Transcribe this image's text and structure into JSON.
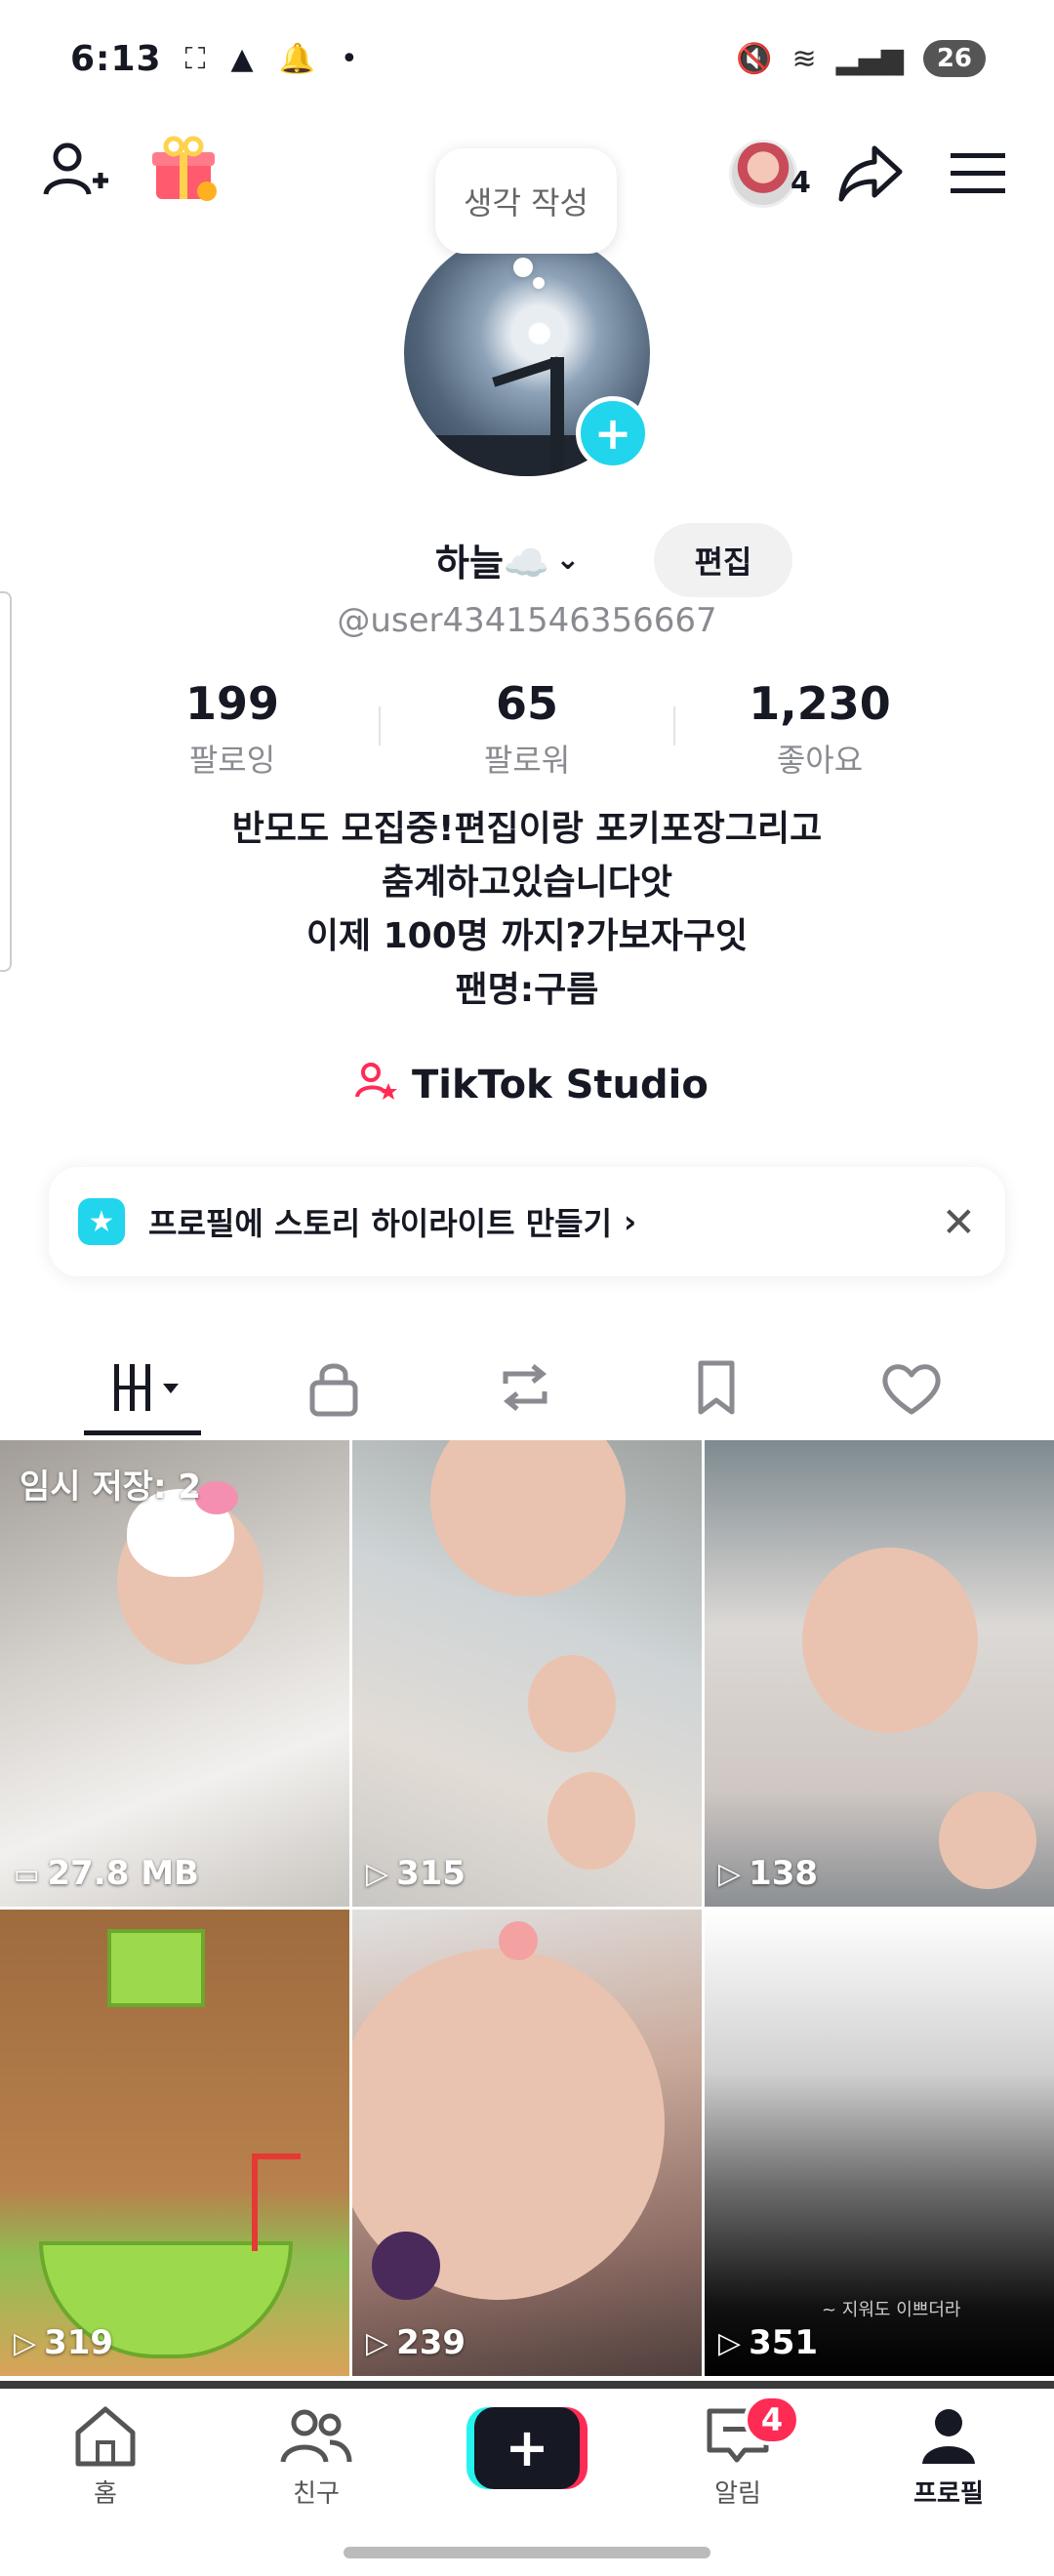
{
  "status_bar": {
    "time": "6:13",
    "battery": "26"
  },
  "top_nav": {
    "avatar_count": "4"
  },
  "thought_bubble": {
    "text": "생각 작성"
  },
  "profile": {
    "display_name": "하늘☁️",
    "edit_label": "편집",
    "username": "@user4341546356667"
  },
  "stats": {
    "following": {
      "value": "199",
      "label": "팔로잉"
    },
    "followers": {
      "value": "65",
      "label": "팔로워"
    },
    "likes": {
      "value": "1,230",
      "label": "좋아요"
    }
  },
  "bio": {
    "lines": [
      "반모도 모집중!편집이랑 포키포장그리고",
      "춤계하고있습니다앗",
      "이제 100명 까지?가보자구잇",
      "팬명:구름"
    ]
  },
  "studio": {
    "label": "TikTok Studio"
  },
  "story_banner": {
    "text": "프로필에 스토리 하이라이트 만들기"
  },
  "tabs": [
    {
      "name": "videos",
      "icon": "grid-icon"
    },
    {
      "name": "private",
      "icon": "lock-icon"
    },
    {
      "name": "reposts",
      "icon": "repost-icon"
    },
    {
      "name": "saved",
      "icon": "bookmark-icon"
    },
    {
      "name": "liked",
      "icon": "heart-icon"
    }
  ],
  "videos": [
    {
      "label": "임시 저장: 2",
      "meta": "27.8 MB",
      "icon": "draft-icon"
    },
    {
      "meta": "315",
      "icon": "play-icon"
    },
    {
      "meta": "138",
      "icon": "play-icon"
    },
    {
      "meta": "319",
      "icon": "play-icon"
    },
    {
      "meta": "239",
      "icon": "play-icon"
    },
    {
      "meta": "351",
      "icon": "play-icon",
      "caption": "~ 지워도 이쁘더라"
    }
  ],
  "bottom_nav": {
    "home": "홈",
    "friends": "친구",
    "inbox": "알림",
    "inbox_badge": "4",
    "profile": "프로필"
  },
  "colors": {
    "accent_pink": "#fe2c55",
    "accent_cyan": "#20d5ec",
    "text": "#161823"
  }
}
